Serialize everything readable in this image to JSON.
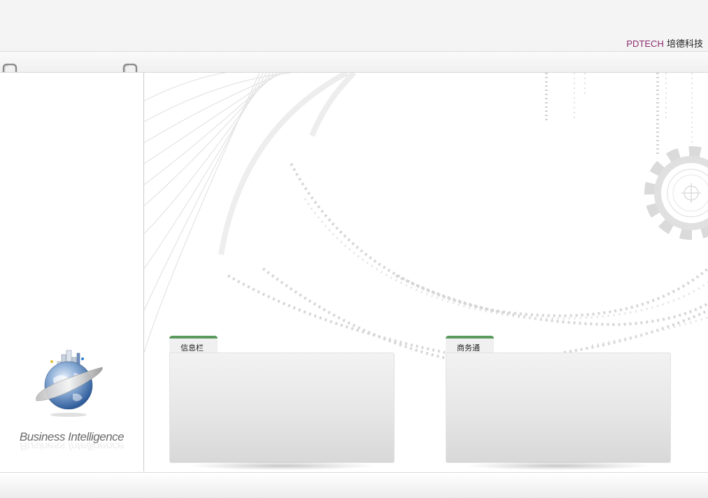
{
  "header": {
    "brand_en": "PDTECH",
    "brand_zh": "培德科技",
    "brand_en_color": "#8b2d6f"
  },
  "sidebar": {
    "logo_icon": "globe-city-icon",
    "tagline": "Business Intelligence"
  },
  "panels": [
    {
      "title": "信息栏"
    },
    {
      "title": "商务通"
    }
  ],
  "background": {
    "binary_vertical": "rorrororroroIro",
    "binary_vertical_2": "IoIoIoIIIoIoIoIIoIo",
    "binary_arc": "0000000000000000000000000000000000000000000000000",
    "gear_icon": "gear-icon"
  },
  "colors": {
    "tab_accent": "#5a9a5c",
    "sidebar_border": "#cccccc"
  }
}
